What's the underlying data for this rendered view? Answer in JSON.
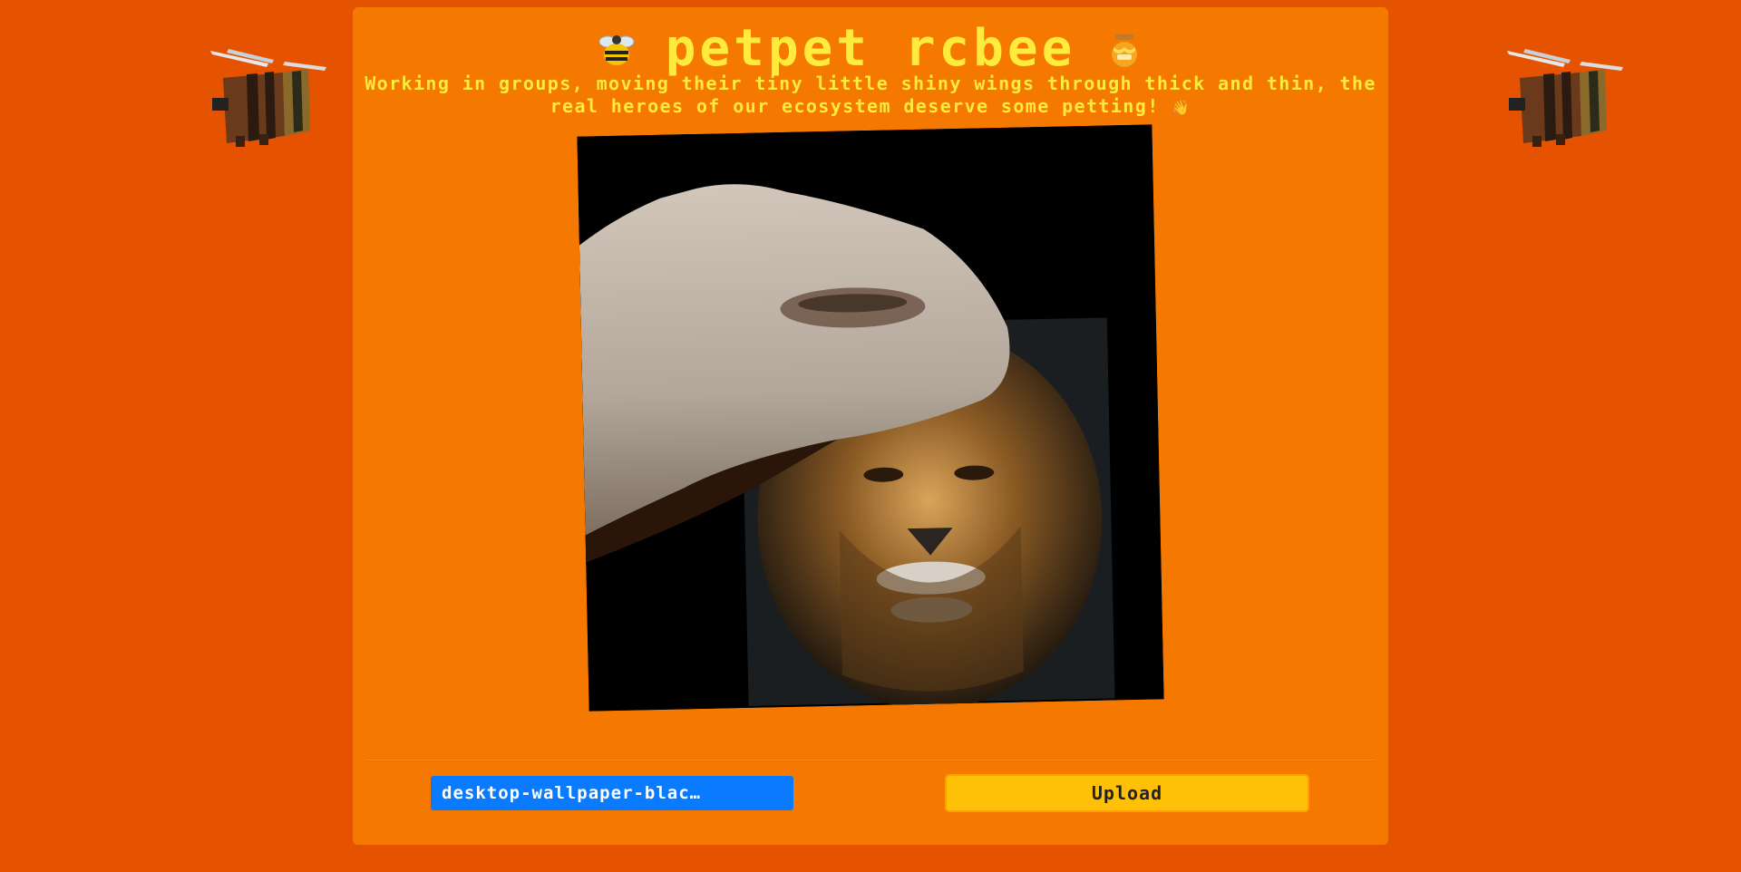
{
  "header": {
    "title": "petpet rcbee",
    "subtitle": "Working in groups, moving their tiny little shiny wings through thick and thin, the real heroes of our ecosystem deserve some petting!",
    "subtitle_emoji": "👋"
  },
  "decorations": {
    "left_bee_icon": "minecraft-bee-icon",
    "right_bee_icon": "minecraft-bee-icon",
    "title_left_icon": "honeybee-emoji-icon",
    "title_right_icon": "honey-pot-emoji-icon"
  },
  "preview": {
    "description_icon": "petpet-hand-over-lion-image"
  },
  "controls": {
    "file_input_label": "desktop-wallpaper-blac…",
    "upload_label": "Upload"
  },
  "colors": {
    "page_background": "#e55300",
    "card_background": "#f57800",
    "title_text": "#ffeb3b",
    "file_button": "#0a7bff",
    "upload_button": "#ffc107"
  }
}
